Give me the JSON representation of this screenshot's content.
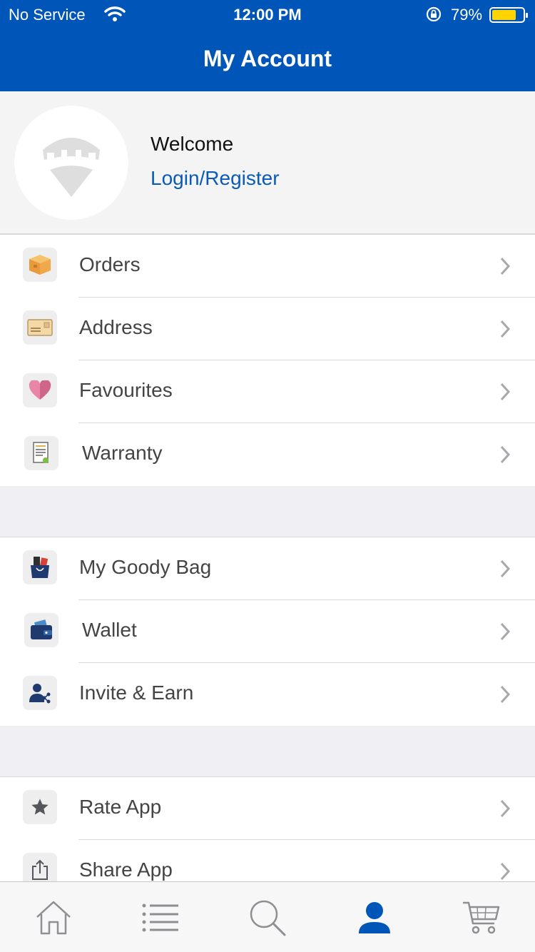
{
  "status_bar": {
    "carrier": "No Service",
    "time": "12:00 PM",
    "battery_percent": "79%",
    "battery_level": 0.79
  },
  "header": {
    "title": "My Account"
  },
  "profile": {
    "welcome": "Welcome",
    "login_link": "Login/Register",
    "avatar_icon": "store-pin-icon"
  },
  "menu_groups": [
    [
      {
        "label": "Orders",
        "icon": "box-icon"
      },
      {
        "label": "Address",
        "icon": "envelope-icon"
      },
      {
        "label": "Favourites",
        "icon": "heart-icon"
      },
      {
        "label": "Warranty",
        "icon": "document-icon"
      }
    ],
    [
      {
        "label": "My Goody Bag",
        "icon": "bag-icon"
      },
      {
        "label": "Wallet",
        "icon": "wallet-icon"
      },
      {
        "label": "Invite & Earn",
        "icon": "user-share-icon"
      }
    ],
    [
      {
        "label": "Rate App",
        "icon": "star-icon"
      },
      {
        "label": "Share App",
        "icon": "share-icon"
      }
    ]
  ],
  "tab_bar": {
    "tabs": [
      "home-icon",
      "list-icon",
      "search-icon",
      "account-icon",
      "cart-icon"
    ],
    "active": "account-icon"
  },
  "colors": {
    "brand_blue": "#0055b8",
    "link_blue": "#0a5ab8",
    "battery_yellow": "#ffd400"
  }
}
